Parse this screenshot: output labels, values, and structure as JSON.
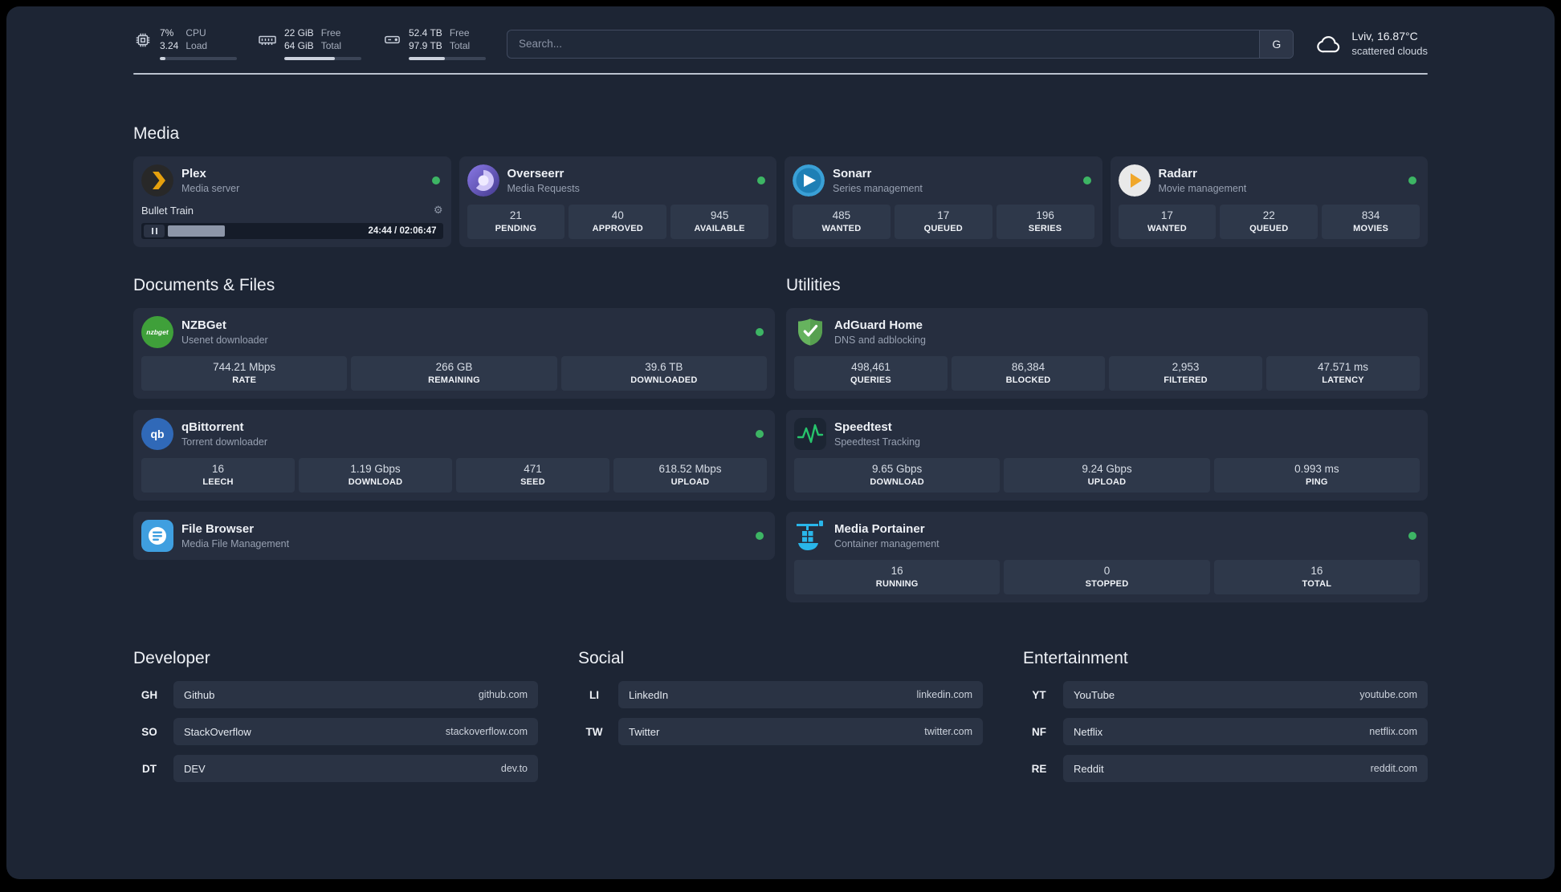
{
  "colors": {
    "status_online": "#3db564",
    "plex_accent": "#e5a00d",
    "adguard_green": "#66b35e",
    "portainer_blue": "#29b6ea",
    "speedtest_green": "#27c46c"
  },
  "topbar": {
    "cpu": {
      "line1": "7%",
      "line2": "3.24",
      "label_line1": "CPU",
      "label_line2": "Load",
      "percent": 7
    },
    "ram": {
      "line1": "22 GiB",
      "line2": "64 GiB",
      "label_line1": "Free",
      "label_line2": "Total",
      "percent": 66
    },
    "disk": {
      "line1": "52.4 TB",
      "line2": "97.9 TB",
      "label_line1": "Free",
      "label_line2": "Total",
      "percent": 47
    },
    "search": {
      "placeholder": "Search...",
      "engine_label": "G"
    },
    "weather": {
      "location": "Lviv, 16.87°C",
      "condition": "scattered clouds"
    }
  },
  "media": {
    "title": "Media",
    "plex": {
      "name": "Plex",
      "subtitle": "Media server",
      "now_playing": "Bullet Train",
      "time": "24:44 / 02:06:47",
      "progress_percent": 19
    },
    "overseerr": {
      "name": "Overseerr",
      "subtitle": "Media Requests",
      "stats": [
        {
          "value": "21",
          "label": "PENDING"
        },
        {
          "value": "40",
          "label": "APPROVED"
        },
        {
          "value": "945",
          "label": "AVAILABLE"
        }
      ]
    },
    "sonarr": {
      "name": "Sonarr",
      "subtitle": "Series management",
      "stats": [
        {
          "value": "485",
          "label": "WANTED"
        },
        {
          "value": "17",
          "label": "QUEUED"
        },
        {
          "value": "196",
          "label": "SERIES"
        }
      ]
    },
    "radarr": {
      "name": "Radarr",
      "subtitle": "Movie management",
      "stats": [
        {
          "value": "17",
          "label": "WANTED"
        },
        {
          "value": "22",
          "label": "QUEUED"
        },
        {
          "value": "834",
          "label": "MOVIES"
        }
      ]
    }
  },
  "documents": {
    "title": "Documents & Files",
    "nzbget": {
      "name": "NZBGet",
      "subtitle": "Usenet downloader",
      "icon_text": "nzbget",
      "stats": [
        {
          "value": "744.21 Mbps",
          "label": "RATE"
        },
        {
          "value": "266 GB",
          "label": "REMAINING"
        },
        {
          "value": "39.6 TB",
          "label": "DOWNLOADED"
        }
      ]
    },
    "qbittorrent": {
      "name": "qBittorrent",
      "subtitle": "Torrent downloader",
      "icon_text": "qb",
      "stats": [
        {
          "value": "16",
          "label": "LEECH"
        },
        {
          "value": "1.19 Gbps",
          "label": "DOWNLOAD"
        },
        {
          "value": "471",
          "label": "SEED"
        },
        {
          "value": "618.52 Mbps",
          "label": "UPLOAD"
        }
      ]
    },
    "filebrowser": {
      "name": "File Browser",
      "subtitle": "Media File Management"
    }
  },
  "utilities": {
    "title": "Utilities",
    "adguard": {
      "name": "AdGuard Home",
      "subtitle": "DNS and adblocking",
      "stats": [
        {
          "value": "498,461",
          "label": "QUERIES"
        },
        {
          "value": "86,384",
          "label": "BLOCKED"
        },
        {
          "value": "2,953",
          "label": "FILTERED"
        },
        {
          "value": "47.571 ms",
          "label": "LATENCY"
        }
      ]
    },
    "speedtest": {
      "name": "Speedtest",
      "subtitle": "Speedtest Tracking",
      "stats": [
        {
          "value": "9.65 Gbps",
          "label": "DOWNLOAD"
        },
        {
          "value": "9.24 Gbps",
          "label": "UPLOAD"
        },
        {
          "value": "0.993 ms",
          "label": "PING"
        }
      ]
    },
    "portainer": {
      "name": "Media Portainer",
      "subtitle": "Container management",
      "stats": [
        {
          "value": "16",
          "label": "RUNNING"
        },
        {
          "value": "0",
          "label": "STOPPED"
        },
        {
          "value": "16",
          "label": "TOTAL"
        }
      ]
    }
  },
  "bookmarks": {
    "developer": {
      "title": "Developer",
      "items": [
        {
          "abbr": "GH",
          "name": "Github",
          "url": "github.com"
        },
        {
          "abbr": "SO",
          "name": "StackOverflow",
          "url": "stackoverflow.com"
        },
        {
          "abbr": "DT",
          "name": "DEV",
          "url": "dev.to"
        }
      ]
    },
    "social": {
      "title": "Social",
      "items": [
        {
          "abbr": "LI",
          "name": "LinkedIn",
          "url": "linkedin.com"
        },
        {
          "abbr": "TW",
          "name": "Twitter",
          "url": "twitter.com"
        }
      ]
    },
    "entertainment": {
      "title": "Entertainment",
      "items": [
        {
          "abbr": "YT",
          "name": "YouTube",
          "url": "youtube.com"
        },
        {
          "abbr": "NF",
          "name": "Netflix",
          "url": "netflix.com"
        },
        {
          "abbr": "RE",
          "name": "Reddit",
          "url": "reddit.com"
        }
      ]
    }
  }
}
